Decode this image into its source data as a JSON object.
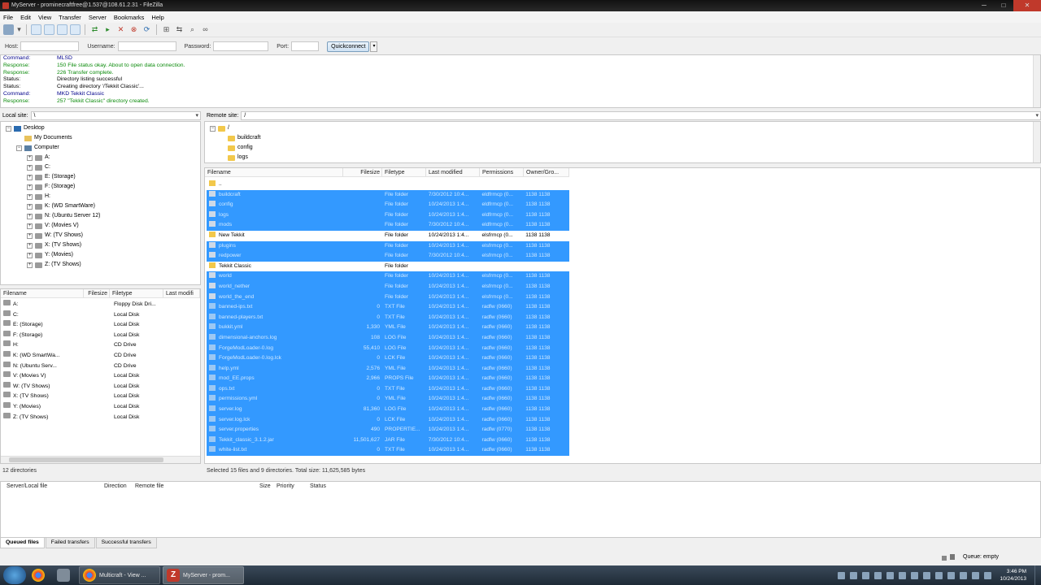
{
  "window": {
    "title": "MyServer - prominecraftfree@1.537@108.61.2.31 - FileZilla",
    "min": "─",
    "max": "□",
    "close": "✕"
  },
  "menu": [
    "File",
    "Edit",
    "View",
    "Transfer",
    "Server",
    "Bookmarks",
    "Help"
  ],
  "quickconnect": {
    "host_label": "Host:",
    "username_label": "Username:",
    "password_label": "Password:",
    "port_label": "Port:",
    "button": "Quickconnect",
    "dropdown": "▾"
  },
  "log": [
    {
      "k": "Command:",
      "m": "MLSD",
      "t": "cmd"
    },
    {
      "k": "Response:",
      "m": "150 File status okay.  About to open data connection.",
      "t": "resp"
    },
    {
      "k": "Response:",
      "m": "226 Transfer complete.",
      "t": "resp"
    },
    {
      "k": "Status:",
      "m": "Directory listing successful",
      "t": "stat"
    },
    {
      "k": "Status:",
      "m": "Creating directory '/Tekkit Classic'...",
      "t": "stat"
    },
    {
      "k": "Command:",
      "m": "MKD Tekkit Classic",
      "t": "cmd"
    },
    {
      "k": "Response:",
      "m": "257 \"Tekkit Classic\" directory created.",
      "t": "resp"
    }
  ],
  "local": {
    "site_label": "Local site:",
    "path": "\\",
    "tree": [
      {
        "label": "Desktop",
        "icon": "desk",
        "indent": 0,
        "exp": "−"
      },
      {
        "label": "My Documents",
        "icon": "docs",
        "indent": 1,
        "exp": ""
      },
      {
        "label": "Computer",
        "icon": "comp",
        "indent": 1,
        "exp": "−"
      },
      {
        "label": "A:",
        "icon": "drive",
        "indent": 2,
        "exp": "+"
      },
      {
        "label": "C:",
        "icon": "drive",
        "indent": 2,
        "exp": "+"
      },
      {
        "label": "E: (Storage)",
        "icon": "drive",
        "indent": 2,
        "exp": "+"
      },
      {
        "label": "F: (Storage)",
        "icon": "drive",
        "indent": 2,
        "exp": "+"
      },
      {
        "label": "H:",
        "icon": "drive",
        "indent": 2,
        "exp": "+"
      },
      {
        "label": "K: (WD SmartWare)",
        "icon": "drive",
        "indent": 2,
        "exp": "+"
      },
      {
        "label": "N: (Ubuntu Server 12)",
        "icon": "drive",
        "indent": 2,
        "exp": "+"
      },
      {
        "label": "V: (Movies V)",
        "icon": "drive",
        "indent": 2,
        "exp": "+"
      },
      {
        "label": "W: (TV Shows)",
        "icon": "drive",
        "indent": 2,
        "exp": "+"
      },
      {
        "label": "X: (TV Shows)",
        "icon": "drive",
        "indent": 2,
        "exp": "+"
      },
      {
        "label": "Y: (Movies)",
        "icon": "drive",
        "indent": 2,
        "exp": "+"
      },
      {
        "label": "Z: (TV Shows)",
        "icon": "drive",
        "indent": 2,
        "exp": "+"
      }
    ],
    "columns": [
      "Filename",
      "Filesize",
      "Filetype",
      "Last modifi"
    ],
    "files": [
      {
        "name": "A:",
        "type": "Floppy Disk Dri..."
      },
      {
        "name": "C:",
        "type": "Local Disk"
      },
      {
        "name": "E: (Storage)",
        "type": "Local Disk"
      },
      {
        "name": "F: (Storage)",
        "type": "Local Disk"
      },
      {
        "name": "H:",
        "type": "CD Drive"
      },
      {
        "name": "K: (WD SmartWa...",
        "type": "CD Drive"
      },
      {
        "name": "N: (Ubuntu Serv...",
        "type": "CD Drive"
      },
      {
        "name": "V: (Movies V)",
        "type": "Local Disk"
      },
      {
        "name": "W: (TV Shows)",
        "type": "Local Disk"
      },
      {
        "name": "X: (TV Shows)",
        "type": "Local Disk"
      },
      {
        "name": "Y: (Movies)",
        "type": "Local Disk"
      },
      {
        "name": "Z: (TV Shows)",
        "type": "Local Disk"
      }
    ],
    "status": "12 directories"
  },
  "remote": {
    "site_label": "Remote site:",
    "path": "/",
    "tree": [
      {
        "label": "/",
        "indent": 0
      },
      {
        "label": "buildcraft",
        "indent": 1
      },
      {
        "label": "config",
        "indent": 1
      },
      {
        "label": "logs",
        "indent": 1
      }
    ],
    "columns": [
      "Filename",
      "Filesize",
      "Filetype",
      "Last modified",
      "Permissions",
      "Owner/Gro..."
    ],
    "files": [
      {
        "name": "..",
        "size": "",
        "type": "",
        "modified": "",
        "perms": "",
        "owner": "",
        "sel": false,
        "folder": true
      },
      {
        "name": "buildcraft",
        "size": "",
        "type": "File folder",
        "modified": "7/30/2012 10:4...",
        "perms": "eldfrmcp (0...",
        "owner": "1138 1138",
        "sel": true,
        "folder": true
      },
      {
        "name": "config",
        "size": "",
        "type": "File folder",
        "modified": "10/24/2013 1:4...",
        "perms": "eldfrmcp (0...",
        "owner": "1138 1138",
        "sel": true,
        "folder": true
      },
      {
        "name": "logs",
        "size": "",
        "type": "File folder",
        "modified": "10/24/2013 1:4...",
        "perms": "eldfrmcp (0...",
        "owner": "1138 1138",
        "sel": true,
        "folder": true
      },
      {
        "name": "mods",
        "size": "",
        "type": "File folder",
        "modified": "7/30/2012 10:4...",
        "perms": "eldfrmcp (0...",
        "owner": "1138 1138",
        "sel": true,
        "folder": true
      },
      {
        "name": "New Tekkit",
        "size": "",
        "type": "File folder",
        "modified": "10/24/2013 1:4...",
        "perms": "elsfrmcp (0...",
        "owner": "1138 1138",
        "sel": false,
        "folder": true
      },
      {
        "name": "plugins",
        "size": "",
        "type": "File folder",
        "modified": "10/24/2013 1:4...",
        "perms": "elsfrmcp (0...",
        "owner": "1138 1138",
        "sel": true,
        "folder": true
      },
      {
        "name": "redpower",
        "size": "",
        "type": "File folder",
        "modified": "7/30/2012 10:4...",
        "perms": "elsfrmcp (0...",
        "owner": "1138 1138",
        "sel": true,
        "folder": true
      },
      {
        "name": "Tekkit Classic",
        "size": "",
        "type": "File folder",
        "modified": "",
        "perms": "",
        "owner": "",
        "sel": false,
        "folder": true
      },
      {
        "name": "world",
        "size": "",
        "type": "File folder",
        "modified": "10/24/2013 1:4...",
        "perms": "elsfrmcp (0...",
        "owner": "1138 1138",
        "sel": true,
        "folder": true
      },
      {
        "name": "world_nether",
        "size": "",
        "type": "File folder",
        "modified": "10/24/2013 1:4...",
        "perms": "elsfrmcp (0...",
        "owner": "1138 1138",
        "sel": true,
        "folder": true
      },
      {
        "name": "world_the_end",
        "size": "",
        "type": "File folder",
        "modified": "10/24/2013 1:4...",
        "perms": "elsfrmcp (0...",
        "owner": "1138 1138",
        "sel": true,
        "folder": true
      },
      {
        "name": "banned-ips.txt",
        "size": "0",
        "type": "TXT File",
        "modified": "10/24/2013 1:4...",
        "perms": "radfw (0660)",
        "owner": "1138 1138",
        "sel": true,
        "folder": false
      },
      {
        "name": "banned-players.txt",
        "size": "0",
        "type": "TXT File",
        "modified": "10/24/2013 1:4...",
        "perms": "radfw (0660)",
        "owner": "1138 1138",
        "sel": true,
        "folder": false
      },
      {
        "name": "bukkit.yml",
        "size": "1,330",
        "type": "YML File",
        "modified": "10/24/2013 1:4...",
        "perms": "radfw (0660)",
        "owner": "1138 1138",
        "sel": true,
        "folder": false
      },
      {
        "name": "dimensional-anchors.log",
        "size": "108",
        "type": "LOG File",
        "modified": "10/24/2013 1:4...",
        "perms": "radfw (0660)",
        "owner": "1138 1138",
        "sel": true,
        "folder": false
      },
      {
        "name": "ForgeModLoader-0.log",
        "size": "55,410",
        "type": "LOG File",
        "modified": "10/24/2013 1:4...",
        "perms": "radfw (0660)",
        "owner": "1138 1138",
        "sel": true,
        "folder": false
      },
      {
        "name": "ForgeModLoader-0.log.lck",
        "size": "0",
        "type": "LCK File",
        "modified": "10/24/2013 1:4...",
        "perms": "radfw (0660)",
        "owner": "1138 1138",
        "sel": true,
        "folder": false
      },
      {
        "name": "help.yml",
        "size": "2,576",
        "type": "YML File",
        "modified": "10/24/2013 1:4...",
        "perms": "radfw (0660)",
        "owner": "1138 1138",
        "sel": true,
        "folder": false
      },
      {
        "name": "mod_EE.props",
        "size": "2,966",
        "type": "PROPS File",
        "modified": "10/24/2013 1:4...",
        "perms": "radfw (0660)",
        "owner": "1138 1138",
        "sel": true,
        "folder": false
      },
      {
        "name": "ops.txt",
        "size": "0",
        "type": "TXT File",
        "modified": "10/24/2013 1:4...",
        "perms": "radfw (0660)",
        "owner": "1138 1138",
        "sel": true,
        "folder": false
      },
      {
        "name": "permissions.yml",
        "size": "0",
        "type": "YML File",
        "modified": "10/24/2013 1:4...",
        "perms": "radfw (0660)",
        "owner": "1138 1138",
        "sel": true,
        "folder": false
      },
      {
        "name": "server.log",
        "size": "81,360",
        "type": "LOG File",
        "modified": "10/24/2013 1:4...",
        "perms": "radfw (0660)",
        "owner": "1138 1138",
        "sel": true,
        "folder": false
      },
      {
        "name": "server.log.lck",
        "size": "0",
        "type": "LCK File",
        "modified": "10/24/2013 1:4...",
        "perms": "radfw (0660)",
        "owner": "1138 1138",
        "sel": true,
        "folder": false
      },
      {
        "name": "server.properties",
        "size": "490",
        "type": "PROPERTIE...",
        "modified": "10/24/2013 1:4...",
        "perms": "radfw (0770)",
        "owner": "1138 1138",
        "sel": true,
        "folder": false
      },
      {
        "name": "Tekkit_classic_3.1.2.jar",
        "size": "11,501,627",
        "type": "JAR File",
        "modified": "7/30/2012 10:4...",
        "perms": "radfw (0660)",
        "owner": "1138 1138",
        "sel": true,
        "folder": false
      },
      {
        "name": "white-list.txt",
        "size": "0",
        "type": "TXT File",
        "modified": "10/24/2013 1:4...",
        "perms": "radfw (0660)",
        "owner": "1138 1138",
        "sel": true,
        "folder": false
      }
    ],
    "status": "Selected 15 files and 9 directories. Total size: 11,625,585 bytes"
  },
  "queue": {
    "columns": [
      "Server/Local file",
      "Direction",
      "Remote file",
      "Size",
      "Priority",
      "Status"
    ],
    "tabs": [
      "Queued files",
      "Failed transfers",
      "Successful transfers"
    ],
    "status": "Queue: empty"
  },
  "taskbar": {
    "items": [
      "Multicraft - View ...",
      "MyServer - prom..."
    ],
    "time": "3:46 PM",
    "date": "10/24/2013"
  },
  "colors": {
    "selection": "#3399ff",
    "log_command": "#00008b",
    "log_response": "#0a8a0a"
  }
}
